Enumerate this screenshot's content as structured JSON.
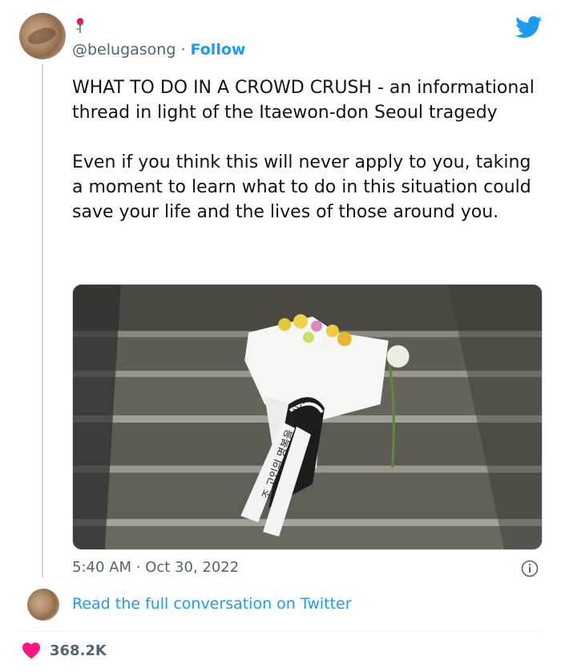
{
  "author": {
    "handle": "@belugasong",
    "separator": "·",
    "follow_label": "Follow",
    "avatar_icon": "profile-avatar",
    "badge_icon": "rose-emoji-icon"
  },
  "brand": {
    "icon": "twitter-bird-icon",
    "color": "#1d9bf0"
  },
  "tweet": {
    "text": "WHAT TO DO IN A CROWD CRUSH - an informational thread in light of the Itaewon-don Seoul tragedy\n\nEven if you think this will never apply to you, taking a moment to learn what to do in this situation could save your life and the lives of those around you.",
    "time": "5:40 AM",
    "separator": "·",
    "date": "Oct 30, 2022"
  },
  "photo": {
    "ribbon_text": "조 고인의 명복을 빕니다"
  },
  "actions": {
    "read_more_label": "Read the full conversation on Twitter",
    "like_count": "368.2K",
    "like_color": "#f91880"
  }
}
